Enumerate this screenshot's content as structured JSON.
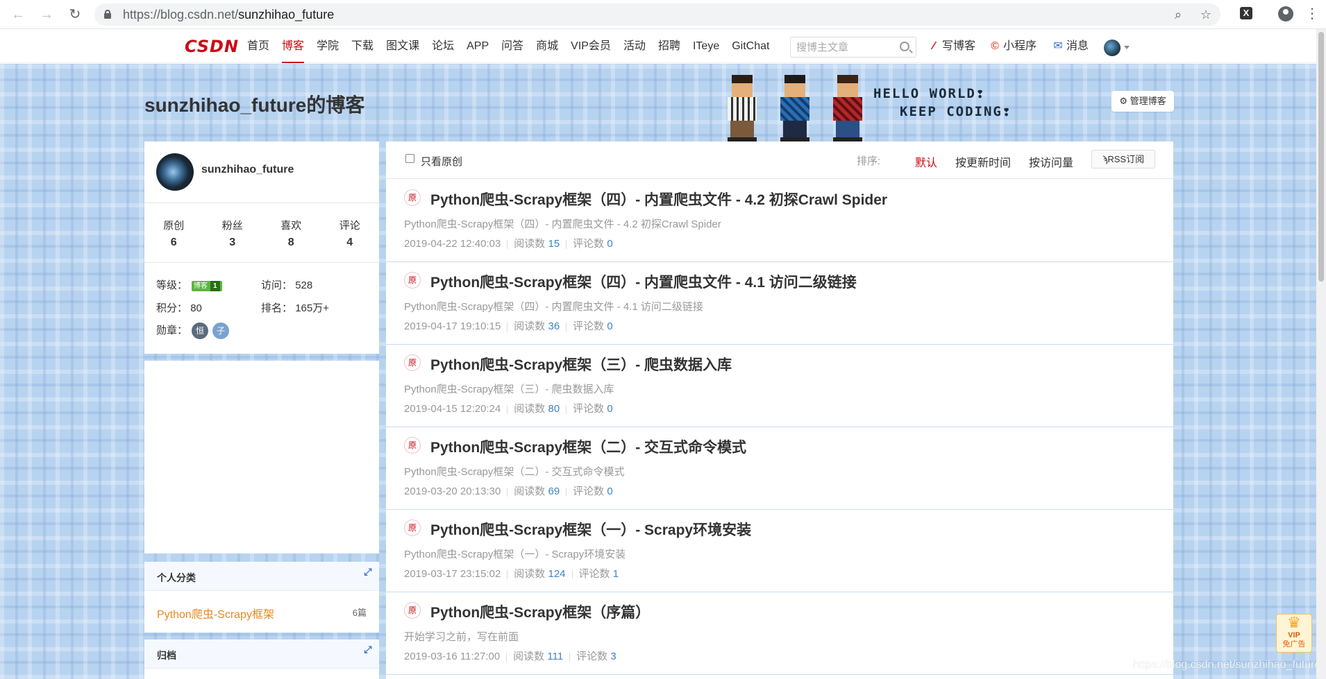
{
  "browser": {
    "url_host": "https://blog.csdn.net/",
    "url_path": "sunzhihao_future",
    "back_icon": "arrow-left-icon",
    "forward_icon": "arrow-right-icon",
    "reload_icon": "reload-icon"
  },
  "toolbar": {
    "logo": "CSDN",
    "nav": [
      "首页",
      "博客",
      "学院",
      "下载",
      "图文课",
      "论坛",
      "APP",
      "问答",
      "商城",
      "VIP会员",
      "活动",
      "招聘",
      "ITeye",
      "GitChat"
    ],
    "active_nav": "博客",
    "search_placeholder": "搜博主文章",
    "write_blog": "写博客",
    "mini_program": "小程序",
    "messages": "消息"
  },
  "header": {
    "blog_title": "sunzhihao_future的博客",
    "banner_line1": "HELLO WORLD❢",
    "banner_line2": "KEEP CODING❢",
    "manage_button": "管理博客"
  },
  "profile": {
    "name": "sunzhihao_future",
    "stats": [
      {
        "label": "原创",
        "value": "6"
      },
      {
        "label": "粉丝",
        "value": "3"
      },
      {
        "label": "喜欢",
        "value": "8"
      },
      {
        "label": "评论",
        "value": "4"
      }
    ],
    "level_label": "等级：",
    "level_badge_text": "博客",
    "level_badge_num": "1",
    "visits_label": "访问：",
    "visits_value": "528",
    "points_label": "积分：",
    "points_value": "80",
    "rank_label": "排名：",
    "rank_value": "165万+",
    "medals_label": "勋章：",
    "medal1": "恒",
    "medal2": "子"
  },
  "categories": {
    "title": "个人分类",
    "items": [
      {
        "name": "Python爬虫-Scrapy框架",
        "count": "6篇"
      }
    ]
  },
  "archive": {
    "title": "归档"
  },
  "list": {
    "only_original": "只看原创",
    "sort_label": "排序:",
    "sort_default": "默认",
    "sort_updated": "按更新时间",
    "sort_views": "按访问量",
    "rss": "RSS订阅",
    "badge": "原",
    "read_label": "阅读数",
    "comment_label": "评论数",
    "articles": [
      {
        "title": "Python爬虫-Scrapy框架（四）- 内置爬虫文件 - 4.2 初探Crawl Spider",
        "desc": "Python爬虫-Scrapy框架（四）- 内置爬虫文件 - 4.2 初探Crawl Spider",
        "date": "2019-04-22 12:40:03",
        "reads": "15",
        "comments": "0"
      },
      {
        "title": "Python爬虫-Scrapy框架（四）- 内置爬虫文件 - 4.1 访问二级链接",
        "desc": "Python爬虫-Scrapy框架（四）- 内置爬虫文件 - 4.1 访问二级链接",
        "date": "2019-04-17 19:10:15",
        "reads": "36",
        "comments": "0"
      },
      {
        "title": "Python爬虫-Scrapy框架（三）- 爬虫数据入库",
        "desc": "Python爬虫-Scrapy框架（三）- 爬虫数据入库",
        "date": "2019-04-15 12:20:24",
        "reads": "80",
        "comments": "0"
      },
      {
        "title": "Python爬虫-Scrapy框架（二）- 交互式命令模式",
        "desc": "Python爬虫-Scrapy框架（二）- 交互式命令模式",
        "date": "2019-03-20 20:13:30",
        "reads": "69",
        "comments": "0"
      },
      {
        "title": "Python爬虫-Scrapy框架（一）- Scrapy环境安装",
        "desc": "Python爬虫-Scrapy框架（一）- Scrapy环境安装",
        "date": "2019-03-17 23:15:02",
        "reads": "124",
        "comments": "1"
      },
      {
        "title": "Python爬虫-Scrapy框架（序篇）",
        "desc": "开始学习之前，写在前面",
        "date": "2019-03-16 11:27:00",
        "reads": "111",
        "comments": "3"
      }
    ]
  },
  "vip_float": {
    "line1": "VIP",
    "line2": "免广告"
  },
  "watermark": "https://blog.csdn.net/sunzhihao_future"
}
